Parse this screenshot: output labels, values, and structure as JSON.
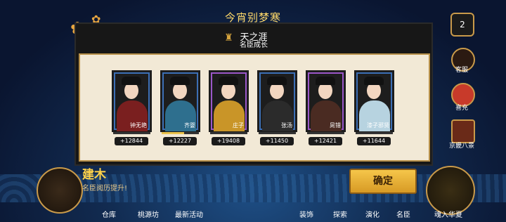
{
  "screen": {
    "banner": "今宵别梦寒"
  },
  "dialog": {
    "title": "天之涯",
    "subtitle": "名臣成长",
    "cards": [
      {
        "name": "钟无艳",
        "gain": "+12844",
        "progress": 0.0,
        "frame": "#3c6fb5",
        "robe": "#7a1f1f"
      },
      {
        "name": "齐婴",
        "gain": "+12227",
        "progress": 0.6,
        "frame": "#3c6fb5",
        "robe": "#2e6f8e"
      },
      {
        "name": "庄子",
        "gain": "+19408",
        "progress": 0.0,
        "frame": "#9b57c9",
        "robe": "#c99528"
      },
      {
        "name": "张汤",
        "gain": "+11450",
        "progress": 0.0,
        "frame": "#3c6fb5",
        "robe": "#2b2b2b"
      },
      {
        "name": "晁错",
        "gain": "+12421",
        "progress": 0.0,
        "frame": "#9b57c9",
        "robe": "#4a2b22"
      },
      {
        "name": "漆子邪贤",
        "gain": "+11644",
        "progress": 0.0,
        "frame": "#3c6fb5",
        "robe": "#b7d3e0"
      }
    ],
    "reward": {
      "name": "建木",
      "desc": "名臣阅历提升!"
    },
    "confirm_label": "确定"
  },
  "side": {
    "badge_count": "2",
    "items": [
      "客服",
      "喜充",
      "京畿八景"
    ]
  },
  "nav": {
    "items": [
      "仓库",
      "桃源坊",
      "最新活动",
      "装饰",
      "探索",
      "演化",
      "名臣"
    ],
    "enter": "魂入华夏"
  }
}
